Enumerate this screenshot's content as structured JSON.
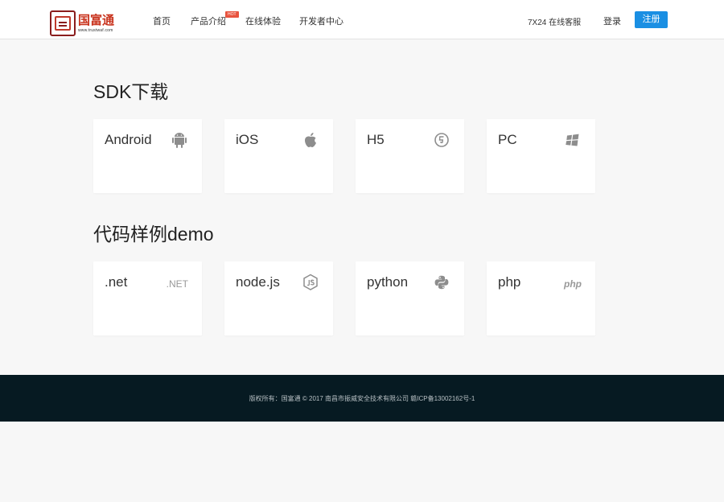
{
  "header": {
    "logo_text": "国富通",
    "logo_sub": "www.trustwaf.com",
    "nav": [
      {
        "label": "首页"
      },
      {
        "label": "产品介绍",
        "badge": "HOT"
      },
      {
        "label": "在线体验"
      },
      {
        "label": "开发者中心"
      }
    ],
    "service": "7X24 在线客服",
    "login": "登录",
    "register": "注册"
  },
  "sdk": {
    "title": "SDK下载",
    "cards": [
      {
        "label": "Android",
        "icon": "android-icon"
      },
      {
        "label": "iOS",
        "icon": "apple-icon"
      },
      {
        "label": "H5",
        "icon": "html5-icon"
      },
      {
        "label": "PC",
        "icon": "windows-icon"
      }
    ]
  },
  "demo": {
    "title": "代码样例demo",
    "cards": [
      {
        "label": ".net",
        "icon": "dotnet-icon",
        "icon_text": ".NET"
      },
      {
        "label": "node.js",
        "icon": "nodejs-icon"
      },
      {
        "label": "python",
        "icon": "python-icon"
      },
      {
        "label": "php",
        "icon": "php-icon",
        "icon_text": "php"
      }
    ]
  },
  "footer": {
    "text": "版权所有：国富通 © 2017 南昌市振威安全技术有限公司 赣ICP备13002162号-1"
  },
  "colors": {
    "accent": "#1a8fe3",
    "footer_bg": "#061a22",
    "hot_badge": "#e8543f",
    "logo_red": "#c8321c"
  }
}
